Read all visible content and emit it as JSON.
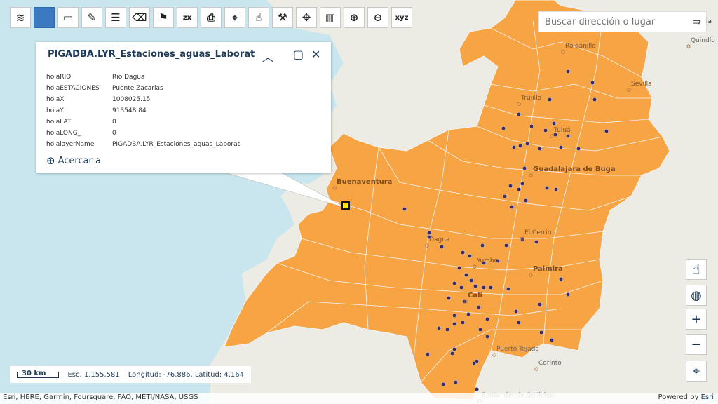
{
  "toolbar": {
    "tools": [
      {
        "name": "layers-icon",
        "glyph": "≋"
      },
      {
        "name": "basemap-icon",
        "glyph": ""
      },
      {
        "name": "measure-icon",
        "glyph": "▭"
      },
      {
        "name": "draw-icon",
        "glyph": "✎"
      },
      {
        "name": "comment-icon",
        "glyph": "☰"
      },
      {
        "name": "eraser-icon",
        "glyph": "⌫"
      },
      {
        "name": "flag-icon",
        "glyph": "⚑"
      },
      {
        "name": "zxy-icon",
        "glyph": "zx"
      },
      {
        "name": "print-icon",
        "glyph": "⎙"
      },
      {
        "name": "map-marker-icon",
        "glyph": "⌖"
      },
      {
        "name": "hand-icon",
        "glyph": "☝"
      },
      {
        "name": "hammer-icon",
        "glyph": "⚒"
      },
      {
        "name": "move-icon",
        "glyph": "✥"
      },
      {
        "name": "split-view-icon",
        "glyph": "▥"
      },
      {
        "name": "zoom-in-icon",
        "glyph": "⊕"
      },
      {
        "name": "zoom-out-icon",
        "glyph": "⊖"
      },
      {
        "name": "xyz-icon",
        "glyph": "xyz"
      }
    ]
  },
  "search": {
    "placeholder": "Buscar dirección o lugar",
    "suffix": "ia"
  },
  "popup": {
    "title": "PIGADBA.LYR_Estaciones_aguas_Laborat",
    "fields": [
      {
        "key": "holaRIO",
        "value": "Rio Dagua"
      },
      {
        "key": "holaESTACIONES",
        "value": "Puente Zacarias"
      },
      {
        "key": "holaX",
        "value": "1008025.15"
      },
      {
        "key": "holaY",
        "value": "913548.84"
      },
      {
        "key": "holaLAT",
        "value": "0"
      },
      {
        "key": "holaLONG_",
        "value": "0"
      },
      {
        "key": "holalayerName",
        "value": "PIGADBA.LYR_Estaciones_aguas_Laborat"
      }
    ],
    "zoom_label": "Acercar a"
  },
  "map": {
    "colors": {
      "water": "#c9e6ee",
      "land": "#ecebe4",
      "region": "#f7a444",
      "point": "#3d2a64",
      "selected": "#ffe600"
    },
    "places": [
      {
        "name": "Quindío",
        "style": "gray"
      },
      {
        "name": "Roldanillo",
        "style": "normal"
      },
      {
        "name": "Sevilla",
        "style": "normal"
      },
      {
        "name": "Trujillo",
        "style": "normal"
      },
      {
        "name": "Tuluá",
        "style": "normal"
      },
      {
        "name": "Guadalajara de Buga",
        "style": "big"
      },
      {
        "name": "Buenaventura",
        "style": "big"
      },
      {
        "name": "El Cerrito",
        "style": "normal"
      },
      {
        "name": "Dagua",
        "style": "normal"
      },
      {
        "name": "Yumbo",
        "style": "normal"
      },
      {
        "name": "Palmira",
        "style": "big"
      },
      {
        "name": "Cali",
        "style": "big"
      },
      {
        "name": "Puerto Tejada",
        "style": "gray"
      },
      {
        "name": "Corinto",
        "style": "gray"
      },
      {
        "name": "Santander de Quilichao",
        "style": "gray"
      }
    ]
  },
  "scale": {
    "bar_label": "30 km",
    "scale_text": "Esc. 1.155.581",
    "coords": "Longitud: -76.886, Latitud: 4.164"
  },
  "attribution": {
    "text": "Esri, HERE, Garmin, Foursquare, FAO, METI/NASA, USGS",
    "powered": "Powered by ",
    "esri": "Esri"
  }
}
